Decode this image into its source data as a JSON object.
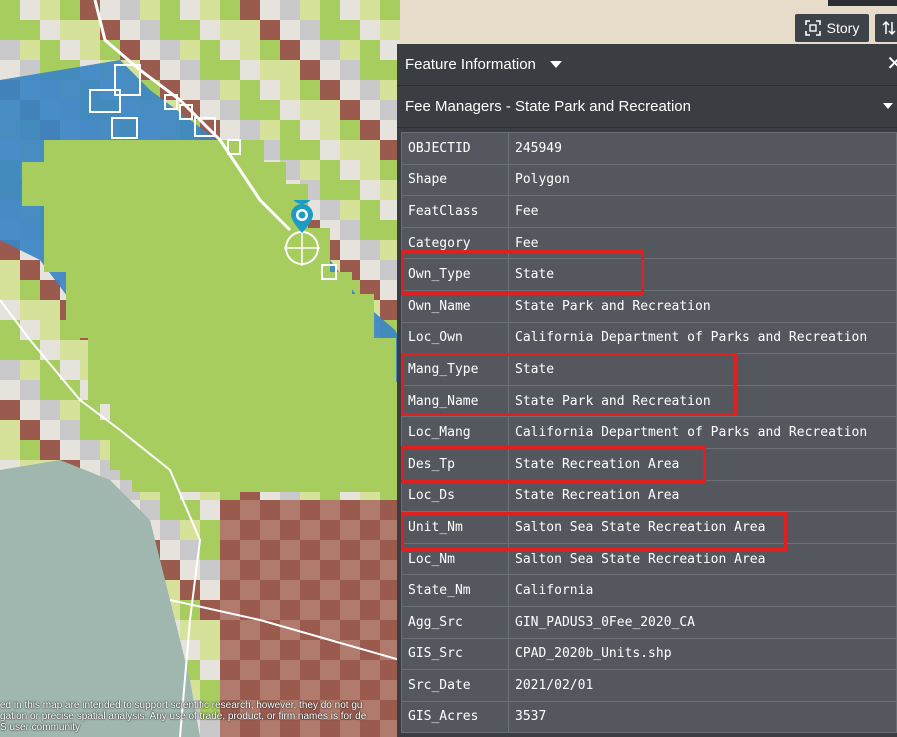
{
  "toolbar": {
    "story_label": "Story"
  },
  "panel": {
    "title": "Feature Information",
    "layer_name": "Fee Managers - State Park and Recreation",
    "close_glyph": "✕",
    "rows": [
      {
        "key": "OBJECTID",
        "value": "245949"
      },
      {
        "key": "Shape",
        "value": "Polygon"
      },
      {
        "key": "FeatClass",
        "value": "Fee"
      },
      {
        "key": "Category",
        "value": "Fee"
      },
      {
        "key": "Own_Type",
        "value": "State"
      },
      {
        "key": "Own_Name",
        "value": "State Park and Recreation"
      },
      {
        "key": "Loc_Own",
        "value": "California Department of Parks and Recreation"
      },
      {
        "key": "Mang_Type",
        "value": "State"
      },
      {
        "key": "Mang_Name",
        "value": "State Park and Recreation"
      },
      {
        "key": "Loc_Mang",
        "value": "California Department of Parks and Recreation"
      },
      {
        "key": "Des_Tp",
        "value": "State Recreation Area"
      },
      {
        "key": "Loc_Ds",
        "value": "State Recreation Area"
      },
      {
        "key": "Unit_Nm",
        "value": "Salton Sea State Recreation Area"
      },
      {
        "key": "Loc_Nm",
        "value": "Salton Sea State Recreation Area"
      },
      {
        "key": "State_Nm",
        "value": "California"
      },
      {
        "key": "Agg_Src",
        "value": "GIN_PADUS3_0Fee_2020_CA"
      },
      {
        "key": "GIS_Src",
        "value": "CPAD_2020b_Units.shp"
      },
      {
        "key": "Src_Date",
        "value": "2021/02/01"
      },
      {
        "key": "GIS_Acres",
        "value": "3537"
      }
    ]
  },
  "map": {
    "attribution_line1": "ed in this map are intended to support scientific research, however, they do not gu",
    "attribution_line2": "gation or precise spatial analysis. Any use of trade, product, or firm names is for de",
    "attribution_line3": "S user community",
    "colors": {
      "lake": "#3b86c4",
      "green": "#a6cd5d",
      "pale_green": "#d6e29a",
      "brown": "#9b5a4e",
      "gray": "#c9c9cc",
      "teal_gray": "#9fb7ae",
      "highlight": "#e0201e"
    }
  },
  "icons": {
    "location_pin": "location-pin-icon",
    "story": "story-icon"
  }
}
